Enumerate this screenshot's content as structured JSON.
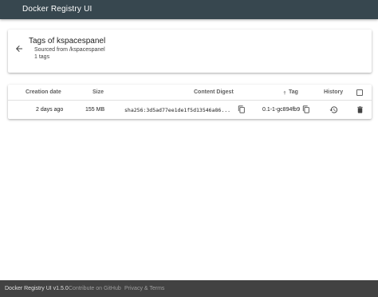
{
  "header": {
    "title": "Docker Registry UI"
  },
  "tags_card": {
    "title": "Tags of kspacespanel",
    "source": "Sourced from /kspacespanel",
    "count": "1 tags"
  },
  "table": {
    "headers": {
      "creation_date": "Creation date",
      "size": "Size",
      "content_digest": "Content Digest",
      "tag": "Tag",
      "history": "History"
    },
    "rows": [
      {
        "creation_date": "2 days ago",
        "size": "155 MB",
        "content_digest": "sha256:3d5ad77ee1de1f5d13546a86...",
        "tag": "0.1-1-gc894fb9"
      }
    ]
  },
  "footer": {
    "version": "Docker Registry UI v1.5.0",
    "github_link": "Contribute on GitHub",
    "privacy_link": "Privacy & Terms"
  },
  "colors": {
    "header_bg": "#37474f",
    "footer_bg": "#424242"
  },
  "icons": [
    "arrow-back-icon",
    "sort-arrow-icon",
    "copy-icon",
    "history-icon",
    "delete-icon",
    "checkbox-icon"
  ]
}
